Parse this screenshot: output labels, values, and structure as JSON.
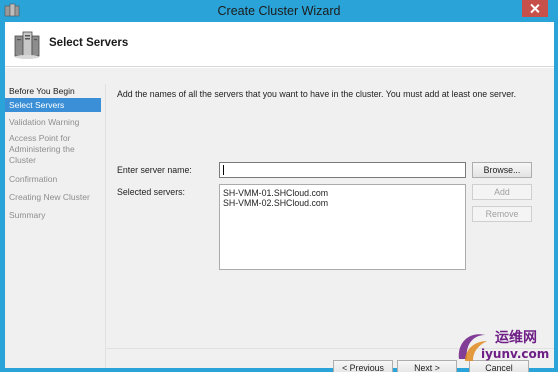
{
  "window": {
    "title": "Create Cluster Wizard"
  },
  "header": {
    "title": "Select Servers"
  },
  "steps": [
    {
      "label": "Before You Begin",
      "state": "done"
    },
    {
      "label": "Select Servers",
      "state": "active"
    },
    {
      "label": "Validation Warning",
      "state": "pending"
    },
    {
      "label": "Access Point for Administering the Cluster",
      "state": "pending"
    },
    {
      "label": "Confirmation",
      "state": "pending"
    },
    {
      "label": "Creating New Cluster",
      "state": "pending"
    },
    {
      "label": "Summary",
      "state": "pending"
    }
  ],
  "main": {
    "instructions": "Add the names of all the servers that you want to have in the cluster. You must add at least one server.",
    "server_name_label": "Enter server name:",
    "server_name_value": "",
    "selected_servers_label": "Selected servers:",
    "selected_servers": [
      "SH-VMM-01.SHCloud.com",
      "SH-VMM-02.SHCloud.com"
    ],
    "browse_label": "Browse...",
    "add_label": "Add",
    "remove_label": "Remove"
  },
  "footer": {
    "previous_label": "< Previous",
    "next_label": "Next >",
    "cancel_label": "Cancel"
  },
  "watermark": {
    "cn": "运维网",
    "en": "iyunv.com"
  },
  "colors": {
    "titlebar": "#2aa4d8",
    "active_step": "#3a8fd6",
    "close": "#c7504a",
    "watermark": "#6e1f86"
  }
}
